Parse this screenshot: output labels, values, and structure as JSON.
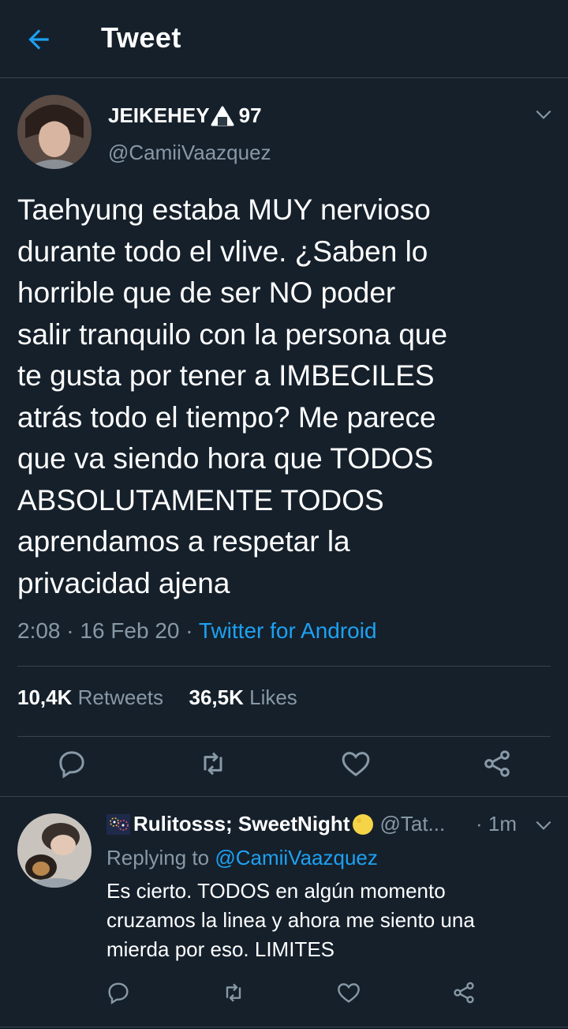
{
  "header": {
    "title": "Tweet"
  },
  "tweet": {
    "author_name": "JEIKEHEY",
    "author_name_suffix": "97",
    "author_handle": "@CamiiVaazquez",
    "text": "Taehyung estaba MUY nervioso\ndurante todo el vlive. ¿Saben lo\nhorrible que de ser NO poder\nsalir tranquilo con la persona que\nte gusta por tener a IMBECILES\natrás todo el tiempo? Me parece\nque va siendo hora que TODOS\nABSOLUTAMENTE TODOS\naprendamos a respetar la\nprivacidad ajena",
    "time": "2:08",
    "date": "16 Feb 20",
    "source": "Twitter for Android",
    "retweets_count": "10,4K",
    "retweets_label": "Retweets",
    "likes_count": "36,5K",
    "likes_label": "Likes"
  },
  "reply": {
    "author_name": "Rulitosss; SweetNight",
    "author_handle": "@Tat...",
    "time": "· 1m",
    "replying_label": "Replying to",
    "replying_handle": "@CamiiVaazquez",
    "text": "Es cierto. TODOS en algún momento\ncruzamos la linea y ahora me siento una\nmierda por eso. LIMITES"
  },
  "colors": {
    "background": "#15202b",
    "accent": "#1da1f2",
    "muted": "#8899a6",
    "border": "#38444d"
  },
  "icons": [
    "back-arrow-icon",
    "chevron-down-icon",
    "onigiri-emoji-icon",
    "fireworks-emoji-icon",
    "crescent-moon-emoji-icon",
    "reply-icon",
    "retweet-icon",
    "like-icon",
    "share-icon"
  ]
}
